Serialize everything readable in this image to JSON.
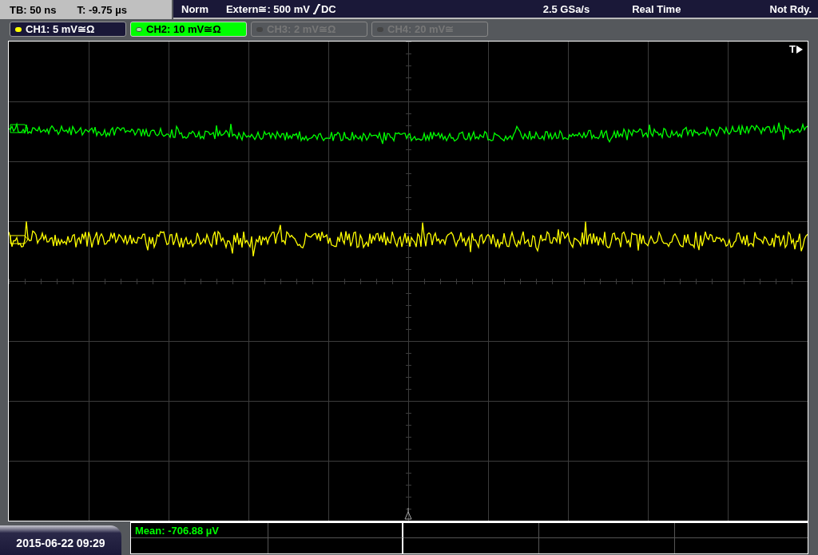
{
  "status_bar": {
    "timebase": "TB: 50 ns",
    "trigger_time": "T: -9.75 µs",
    "trigger_mode": "Norm",
    "trigger_source": "Extern≅: 500 mV",
    "trigger_coupling": "DC",
    "sample_rate": "2.5 GSa/s",
    "acquisition": "Real Time",
    "state": "Not Rdy."
  },
  "channels": [
    {
      "label": "CH1: 5 mV≅Ω",
      "selected": false,
      "enabled": true,
      "color": "#ffff00"
    },
    {
      "label": "CH2: 10 mV≅Ω",
      "selected": true,
      "enabled": true
    },
    {
      "label": "CH3: 2 mV≅Ω",
      "selected": false,
      "enabled": false
    },
    {
      "label": "CH4: 20 mV≅",
      "selected": false,
      "enabled": false
    }
  ],
  "plot": {
    "trigger_marker": "T",
    "traces": [
      {
        "color": "#00ff00"
      },
      {
        "color": "#ffff00"
      }
    ]
  },
  "date_time": "2015-06-22 09:29",
  "measurements": [
    {
      "text": "Mean: -706.88 µV"
    }
  ]
}
